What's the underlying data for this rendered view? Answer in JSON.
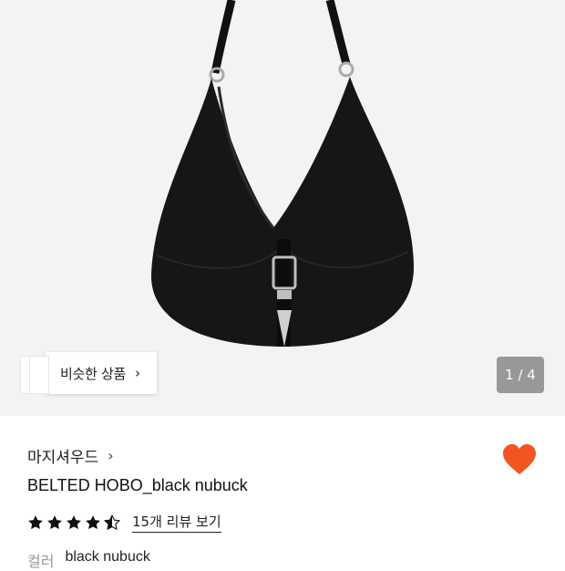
{
  "gallery": {
    "image_alt": "black nubuck hobo bag with belt buckle",
    "similar_label": "비슷한 상품",
    "counter": "1 / 4"
  },
  "product": {
    "brand": "마지셔우드",
    "name": "BELTED HOBO_black nubuck",
    "liked": true,
    "rating": 4.5,
    "review_link": "15개 리뷰 보기",
    "option_label": "컬러",
    "option_value": "black nubuck"
  },
  "colors": {
    "heart": "#f2551f",
    "star": "#111111"
  },
  "icons": {
    "similar_chevron": "chevron-right-icon",
    "brand_chevron": "chevron-right-icon",
    "like": "heart-icon",
    "rating": "star-icon"
  }
}
